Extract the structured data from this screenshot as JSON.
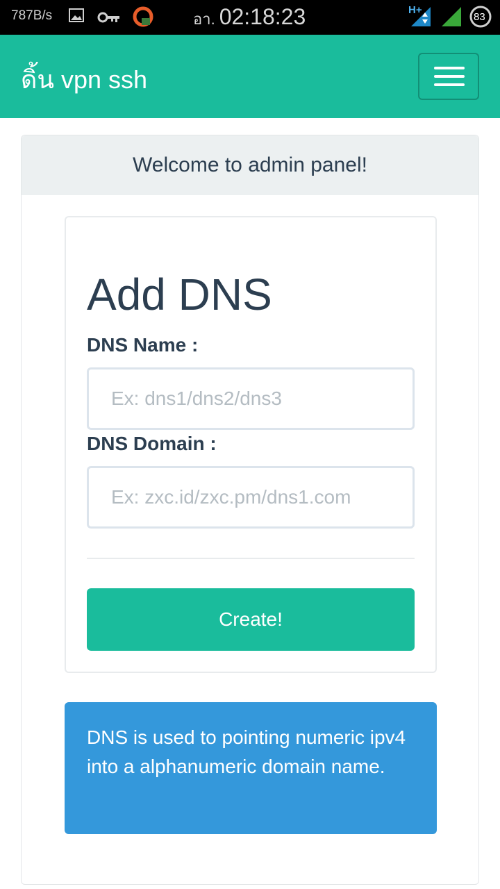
{
  "status_bar": {
    "speed": "787B/s",
    "era": "อา.",
    "time": "02:18:23",
    "network": "H+",
    "battery": "83"
  },
  "navbar": {
    "brand": "ดิ้น vpn ssh"
  },
  "panel": {
    "heading": "Welcome to admin panel!"
  },
  "form": {
    "title": "Add DNS",
    "name_label": "DNS Name :",
    "name_placeholder": "Ex: dns1/dns2/dns3",
    "name_value": "",
    "domain_label": "DNS Domain :",
    "domain_placeholder": "Ex: zxc.id/zxc.pm/dns1.com",
    "domain_value": "",
    "submit_label": "Create!"
  },
  "info": {
    "text": "DNS is used to pointing numeric ipv4 into a alphanumeric domain name."
  },
  "colors": {
    "accent": "#1abc9c",
    "info": "#3498db",
    "text_dark": "#2c3e50"
  }
}
